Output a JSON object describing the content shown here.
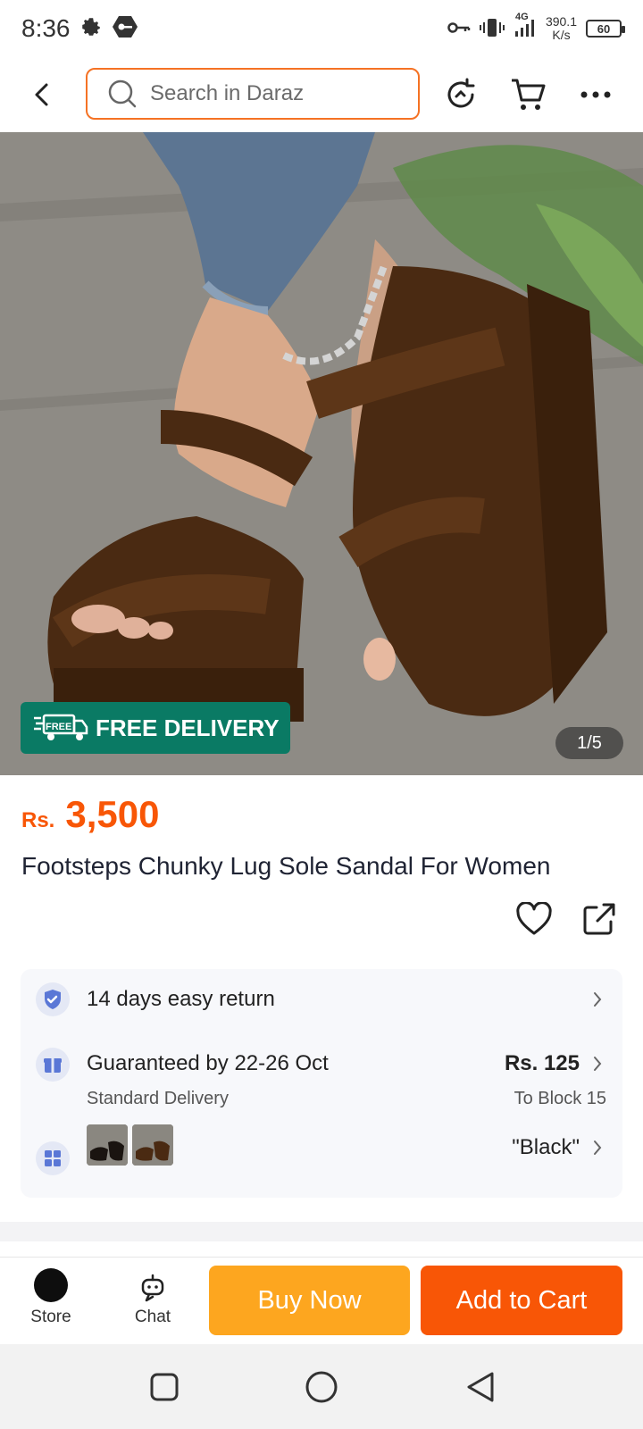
{
  "status_bar": {
    "time": "8:36",
    "network": "4G",
    "speed_value": "390.1",
    "speed_unit": "K/s",
    "battery": "60"
  },
  "header": {
    "search_placeholder": "Search in Daraz"
  },
  "hero": {
    "free_delivery": "FREE DELIVERY",
    "badge_tag": "FREE",
    "photo_counter": "1/5"
  },
  "product": {
    "currency": "Rs.",
    "price": "3,500",
    "title": "Footsteps Chunky Lug Sole Sandal For Women"
  },
  "info": {
    "return_text": "14 days easy return",
    "delivery_title": "Guaranteed by 22-26 Oct",
    "delivery_subtitle": "Standard Delivery",
    "delivery_fee": "Rs. 125",
    "delivery_location": "To Block 15",
    "variant_selected": "\"Black\""
  },
  "action_bar": {
    "store_label": "Store",
    "chat_label": "Chat",
    "buy_now": "Buy Now",
    "add_to_cart": "Add to Cart"
  },
  "colors": {
    "accent_orange": "#f85606",
    "buy_now_yellow": "#fda61f",
    "free_delivery_green": "#0a7a64"
  }
}
